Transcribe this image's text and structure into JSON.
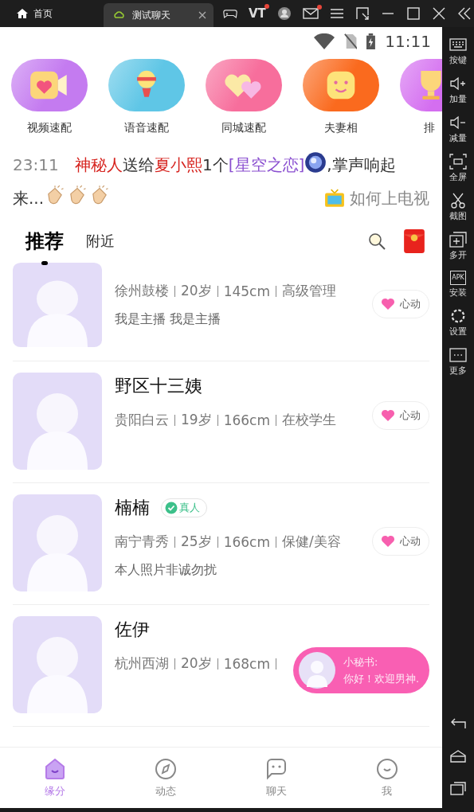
{
  "titlebar": {
    "home_label": "首页",
    "tab": {
      "title": "测试聊天",
      "selected": true
    },
    "vt_label": "VT",
    "vt_dot": true,
    "mail_dot": true
  },
  "status_bar": {
    "time": "11:11"
  },
  "features": [
    {
      "label": "视频速配",
      "kind": "video",
      "color": "#c47bf0"
    },
    {
      "label": "语音速配",
      "kind": "mic",
      "color": "#5fc6e6"
    },
    {
      "label": "同城速配",
      "kind": "hearts",
      "color": "#f76e9c"
    },
    {
      "label": "夫妻相",
      "kind": "face",
      "color": "#fa6a1e"
    },
    {
      "label": "排",
      "kind": "trophy",
      "color": "#d46ef0"
    }
  ],
  "notice": {
    "time": "23:11",
    "segments": [
      {
        "kind": "name",
        "text": "神秘人"
      },
      {
        "kind": "text",
        "text": "送给"
      },
      {
        "kind": "name",
        "text": "夏小熙"
      },
      {
        "kind": "text",
        "text": "1个"
      },
      {
        "kind": "gift",
        "text": "[星空之恋]"
      },
      {
        "kind": "gift_icon"
      },
      {
        "kind": "text",
        "text": ",掌声响起"
      },
      {
        "kind": "text",
        "text": "来..."
      },
      {
        "kind": "clap"
      },
      {
        "kind": "clap"
      },
      {
        "kind": "clap"
      }
    ],
    "tv_link": "如何上电视"
  },
  "tabs": [
    {
      "label": "推荐",
      "selected": true
    },
    {
      "label": "附近",
      "selected": false
    }
  ],
  "users": [
    {
      "tags": [
        "徐州鼓楼",
        "20岁",
        "145cm",
        "高级管理"
      ],
      "bio": "我是主播 我是主播",
      "like": "心动",
      "partial": true
    },
    {
      "name": "野区十三姨",
      "partial": false,
      "verified": false,
      "tags": [
        "贵阳白云",
        "19岁",
        "166cm",
        "在校学生"
      ],
      "like": "心动"
    },
    {
      "name": "楠楠",
      "partial": false,
      "verified": true,
      "badge": "真人",
      "tags": [
        "南宁青秀",
        "25岁",
        "166cm",
        "保健/美容"
      ],
      "bio": "本人照片非诚勿扰",
      "like": "心动"
    },
    {
      "name": "佐伊",
      "partial": false,
      "verified": false,
      "tags": [
        "杭州西湖",
        "20岁",
        "168cm"
      ]
    }
  ],
  "bubble": {
    "title": "小秘书:",
    "message": "你好！欢迎男神."
  },
  "nav": [
    {
      "label": "缘分",
      "kind": "home",
      "selected": true
    },
    {
      "label": "动态",
      "kind": "compass",
      "selected": false
    },
    {
      "label": "聊天",
      "kind": "chat",
      "selected": false
    },
    {
      "label": "我",
      "kind": "me",
      "selected": false
    }
  ],
  "sidebar": [
    {
      "label": "按键",
      "kind": "keyboard"
    },
    {
      "label": "加量",
      "kind": "volup"
    },
    {
      "label": "减量",
      "kind": "voldown"
    },
    {
      "label": "全屏",
      "kind": "fullscreen"
    },
    {
      "label": "截图",
      "kind": "scissors"
    },
    {
      "label": "多开",
      "kind": "multi"
    },
    {
      "label": "安装",
      "kind": "apk",
      "icon_text": "APK"
    },
    {
      "label": "设置",
      "kind": "gear"
    },
    {
      "label": "更多",
      "kind": "more"
    }
  ]
}
